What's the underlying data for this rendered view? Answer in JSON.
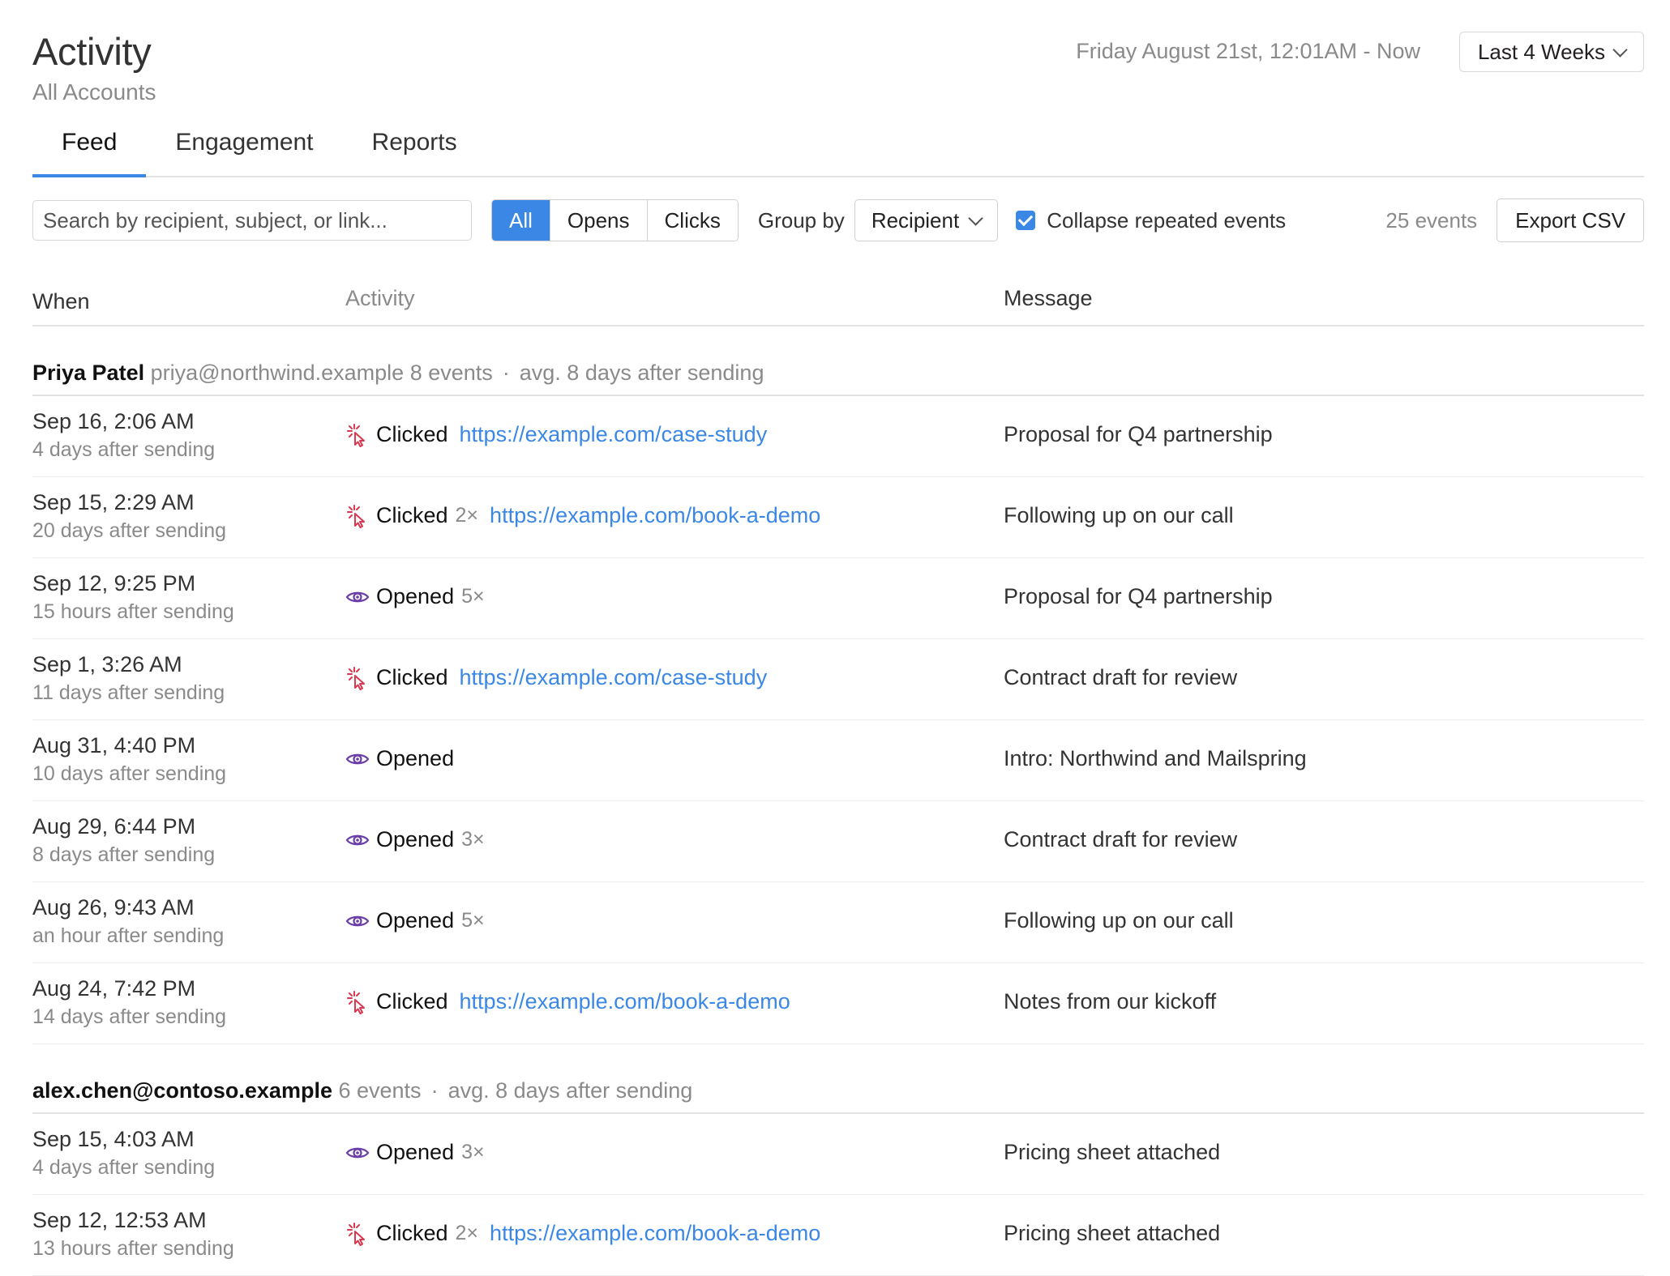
{
  "header": {
    "title": "Activity",
    "subtitle": "All Accounts",
    "date_range": "Friday August 21st, 12:01AM - Now",
    "range_select": "Last 4 Weeks"
  },
  "tabs": [
    {
      "label": "Feed",
      "active": true
    },
    {
      "label": "Engagement",
      "active": false
    },
    {
      "label": "Reports",
      "active": false
    }
  ],
  "toolbar": {
    "search_placeholder": "Search by recipient, subject, or link...",
    "filters": [
      {
        "label": "All",
        "active": true
      },
      {
        "label": "Opens",
        "active": false
      },
      {
        "label": "Clicks",
        "active": false
      }
    ],
    "group_by_label": "Group by",
    "group_by_value": "Recipient",
    "collapse_label": "Collapse repeated events",
    "collapse_checked": true,
    "events_count": "25 events",
    "export_label": "Export CSV"
  },
  "columns": {
    "when": "When",
    "activity": "Activity",
    "message": "Message"
  },
  "colors": {
    "accent": "#3b87e6",
    "click_icon": "#d9384f",
    "open_icon": "#6b3fa8"
  },
  "groups": [
    {
      "name": "Priya Patel",
      "email": "priya@northwind.example",
      "events": "8 events",
      "dot": "·",
      "avg": "avg. 8 days after sending",
      "rows": [
        {
          "time": "Sep 16, 2:06 AM",
          "rel": "4 days after sending",
          "icon": "click-icon",
          "action": "Clicked",
          "count": "",
          "link": "https://example.com/case-study",
          "message": "Proposal for Q4 partnership"
        },
        {
          "time": "Sep 15, 2:29 AM",
          "rel": "20 days after sending",
          "icon": "click-icon",
          "action": "Clicked",
          "count": "2×",
          "link": "https://example.com/book-a-demo",
          "message": "Following up on our call"
        },
        {
          "time": "Sep 12, 9:25 PM",
          "rel": "15 hours after sending",
          "icon": "eye-icon",
          "action": "Opened",
          "count": "5×",
          "link": "",
          "message": "Proposal for Q4 partnership"
        },
        {
          "time": "Sep 1, 3:26 AM",
          "rel": "11 days after sending",
          "icon": "click-icon",
          "action": "Clicked",
          "count": "",
          "link": "https://example.com/case-study",
          "message": "Contract draft for review"
        },
        {
          "time": "Aug 31, 4:40 PM",
          "rel": "10 days after sending",
          "icon": "eye-icon",
          "action": "Opened",
          "count": "",
          "link": "",
          "message": "Intro: Northwind and Mailspring"
        },
        {
          "time": "Aug 29, 6:44 PM",
          "rel": "8 days after sending",
          "icon": "eye-icon",
          "action": "Opened",
          "count": "3×",
          "link": "",
          "message": "Contract draft for review"
        },
        {
          "time": "Aug 26, 9:43 AM",
          "rel": "an hour after sending",
          "icon": "eye-icon",
          "action": "Opened",
          "count": "5×",
          "link": "",
          "message": "Following up on our call"
        },
        {
          "time": "Aug 24, 7:42 PM",
          "rel": "14 days after sending",
          "icon": "click-icon",
          "action": "Clicked",
          "count": "",
          "link": "https://example.com/book-a-demo",
          "message": "Notes from our kickoff"
        }
      ]
    },
    {
      "name": "alex.chen@contoso.example",
      "email": "",
      "events": "6 events",
      "dot": "·",
      "avg": "avg. 8 days after sending",
      "rows": [
        {
          "time": "Sep 15, 4:03 AM",
          "rel": "4 days after sending",
          "icon": "eye-icon",
          "action": "Opened",
          "count": "3×",
          "link": "",
          "message": "Pricing sheet attached"
        },
        {
          "time": "Sep 12, 12:53 AM",
          "rel": "13 hours after sending",
          "icon": "click-icon",
          "action": "Clicked",
          "count": "2×",
          "link": "https://example.com/book-a-demo",
          "message": "Pricing sheet attached"
        }
      ]
    }
  ]
}
